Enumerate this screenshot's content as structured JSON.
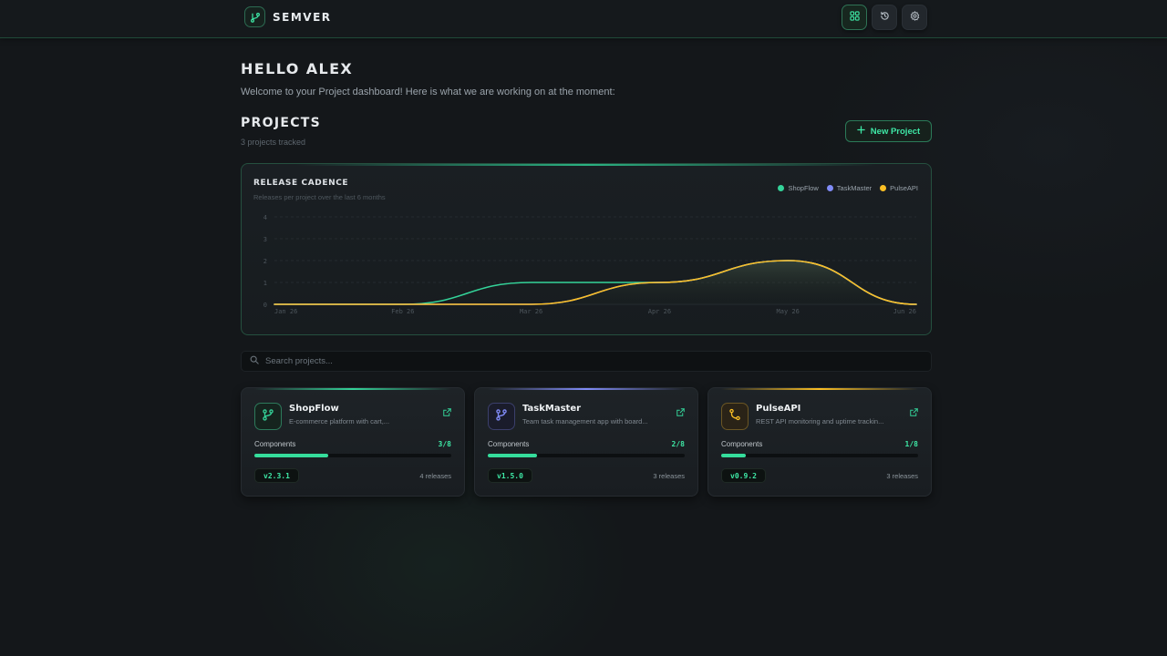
{
  "app": {
    "name": "SEMVER"
  },
  "topbar": {
    "icons": [
      "dashboard-icon",
      "history-icon",
      "settings-icon"
    ]
  },
  "greeting": {
    "title": "HELLO ALEX",
    "subtitle": "Welcome to your Project dashboard! Here is what we are working on at the moment:"
  },
  "projects_section": {
    "title": "PROJECTS",
    "count_text": "3 projects tracked",
    "new_button": "New Project"
  },
  "chart": {
    "title": "RELEASE CADENCE",
    "subtitle": "Releases per project over the last 6 months"
  },
  "chart_data": {
    "type": "line",
    "categories": [
      "Jan 26",
      "Feb 26",
      "Mar 26",
      "Apr 26",
      "May 26",
      "Jun 26"
    ],
    "series": [
      {
        "name": "ShopFlow",
        "color": "#34d399",
        "values": [
          0,
          0,
          1,
          1,
          2,
          0
        ]
      },
      {
        "name": "TaskMaster",
        "color": "#818cf8",
        "values": [
          0,
          0,
          0,
          1,
          2,
          0
        ]
      },
      {
        "name": "PulseAPI",
        "color": "#fbbf24",
        "values": [
          0,
          0,
          0,
          1,
          2,
          0
        ]
      }
    ],
    "ylim": [
      0,
      4
    ],
    "yticks": [
      "0",
      "1",
      "2",
      "3",
      "4"
    ],
    "grid": true,
    "legend_position": "top-right"
  },
  "search": {
    "placeholder": "Search projects..."
  },
  "projects": [
    {
      "name": "ShopFlow",
      "description": "E-commerce platform with cart,...",
      "components_label": "Components",
      "components": "3/8",
      "progress": 0.375,
      "version": "v2.3.1",
      "releases": "4 releases",
      "color": "#34d399"
    },
    {
      "name": "TaskMaster",
      "description": "Team task management app with board...",
      "components_label": "Components",
      "components": "2/8",
      "progress": 0.25,
      "version": "v1.5.0",
      "releases": "3 releases",
      "color": "#818cf8"
    },
    {
      "name": "PulseAPI",
      "description": "REST API monitoring and uptime trackin...",
      "components_label": "Components",
      "components": "1/8",
      "progress": 0.125,
      "version": "v0.9.2",
      "releases": "3 releases",
      "color": "#fbbf24"
    }
  ]
}
